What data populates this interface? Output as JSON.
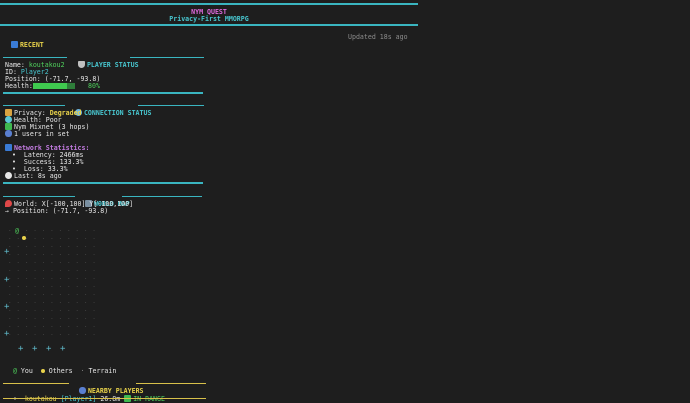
{
  "header": {
    "title": "NYM QUEST",
    "subtitle": "Privacy-First MMORPG"
  },
  "recent": {
    "label": "RECENT",
    "updated": "Updated 18s ago"
  },
  "player_status": {
    "title": "PLAYER STATUS",
    "name_label": "Name:",
    "name": "koutakou2",
    "id_label": "ID:",
    "id": "Player2",
    "position_label": "Position:",
    "position": "(-71.7, -93.8)",
    "health_label": "Health:",
    "health_percent": 80,
    "health_text": "80%"
  },
  "connection_status": {
    "title": "CONNECTION STATUS",
    "privacy_label": "Privacy:",
    "privacy": "Degraded",
    "health_line": "Health: Poor",
    "mixnet": "Nym Mixnet (3 hops)",
    "users": "1 users in set",
    "stats_title": "Network Statistics:",
    "latency": "Latency: 2466ms",
    "success": "Success: 133.3%",
    "loss": "Loss: 33.3%",
    "last": "Last: 8s ago"
  },
  "world_map": {
    "title": "WORLD MAP",
    "world": "World: X[-100,100] Y[-100,100]",
    "position": "Position: (-71.7, -93.8)",
    "you_glyph": "@",
    "cross_glyph": "+",
    "legend_you": "You",
    "legend_others": "Others",
    "legend_terrain": "Terrain"
  },
  "nearby_players": {
    "title": "NEARBY PLAYERS",
    "players": [
      {
        "name": "koutakou",
        "id": "[Player1]",
        "distance": "26.8m",
        "status": "IN RANGE"
      }
    ]
  },
  "colors": {
    "accent_cyan": "#48c6cf",
    "title_magenta": "#e06adf",
    "ok_green": "#4fd05c",
    "warn_yellow": "#e8d24b",
    "stats_purple": "#c27be0"
  }
}
